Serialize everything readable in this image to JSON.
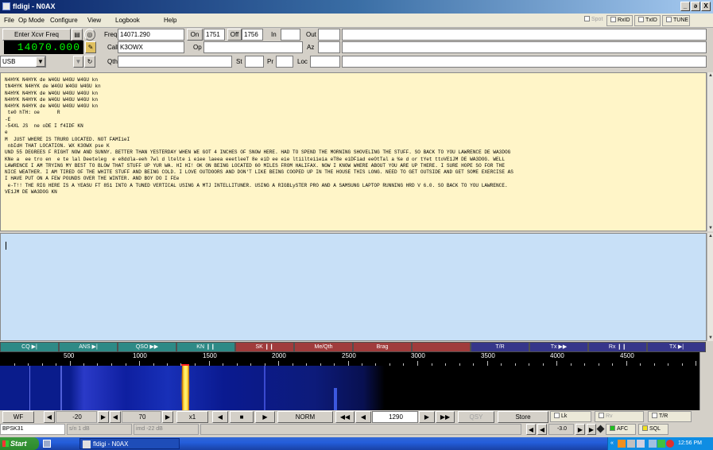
{
  "window": {
    "title": "fldigi - N0AX",
    "controls": [
      "_",
      "ə",
      "X"
    ]
  },
  "menubar": {
    "items": [
      "File",
      "Op Mode",
      "Configure",
      "View",
      "Logbook",
      "Help"
    ],
    "right_buttons": {
      "spot": "Spot",
      "rxid": "RxID",
      "txid": "TxID",
      "tune": "TUNE"
    }
  },
  "fields": {
    "enter_xcvr_freq": "Enter Xcvr Freq",
    "freq_label": "Freq",
    "freq_value": "14071.290",
    "on_label": "On",
    "on_value": "1751",
    "off_label": "Off",
    "off_value": "1756",
    "in_label": "In",
    "in_value": "",
    "out_label": "Out",
    "out_value": "",
    "call_label": "Call",
    "call_value": "K3OWX",
    "op_label": "Op",
    "op_value": "",
    "az_label": "Az",
    "az_value": "",
    "qth_label": "Qth",
    "qth_value": "",
    "st_label": "St",
    "st_value": "",
    "pr_label": "Pr",
    "pr_value": "",
    "loc_label": "Loc",
    "loc_value": "",
    "mode_select": "USB"
  },
  "frequency_display": "14070.000",
  "rx_text": [
    "N4HYK N4HYK de W4GU W4GU W4GU kn",
    "tN4HYK N4HYK de W4GU W4GU W4GU kn",
    "N4HYK N4HYK de W4GU W4GU W4GU kn",
    "N4HYK N4HYK de W4GU W4GU W4GU kn",
    "N4HYK N4HYK de W4GU W4GU W4GU kn",
    " te0 hTH: oe      R",
    "-E",
    "-54XL JS  ne oDE I f4IDF KN",
    "e",
    "M  JUST WHERE IS TRURO LOCATED. NOT FAMIieI",
    " nbIdH THAT LOCATION. WX K3OWX pse K",
    "UND 55 DEGREES F RIGHT NOW AND SUNNY. BETTER THAN YESTERDAY WHEN WE GOT 4 INCHES OF SNOW HERE. HAD TO SPEND THE MORNING SHOVELING THE STUFF. SO BACK TO YOU LAWRENCE DE WA3DOG",
    "KNe a  ee tro en  e te lal Deeteleg  e e8ddla-eeh 7wl d ltelte i eiee laeea eeetleeT 8e eiD ee eie ltiilteiieia eT8e eiDFiad eeOtTal a %e d or tYet ttoVE1JM DE WA3DOG. WELL",
    "LAWRENCE I AM TRYING MY BEST TO BLOW THAT STUFF UP YUR WA. HI HI! OK ON BEING LOCATED 60 MILES FROM HALIFAX. NOW I KNOW WHERE ABOUT YOU ARE UP THERE. I SURE HOPE SO FOR THE",
    "NICE WEATHER. I AM TIRED OF THE WHITE STUFF AND BEING COLD. I LOVE OUTDOORS AND DON'T LIKE BEING COOPED UP IN THE HOUSE THIS LONG. NEED TO GET OUTSIDE AND GET SOME EXERCISE AS",
    "I HAVE PUT ON A FEW POUNDS OVER THE WINTER. AND BOY DO I FEe",
    " e-T!! THE RIG HERE IS A YEASU FT 851 INTO A TUNED VERTICAL USING A MTJ INTELLITUNER. USING A RIGBLySTER PRO AND A SAMSUNG LAPTOP RUNNING HRD V 6.0. SO BACK TO YOU LAWRENCE.",
    "VE1JM DE WA3DOG KN"
  ],
  "tx_text": "",
  "macros": [
    {
      "label": "CQ ▶|",
      "color": "#2e8a86"
    },
    {
      "label": "ANS ▶|",
      "color": "#2e8a86"
    },
    {
      "label": "QSO ▶▶",
      "color": "#2e8a86"
    },
    {
      "label": "KN ❙❙",
      "color": "#2e8a86"
    },
    {
      "label": "SK ❙❙",
      "color": "#a03c3c"
    },
    {
      "label": "Me/Qth",
      "color": "#a03c3c"
    },
    {
      "label": "Brag",
      "color": "#a03c3c"
    },
    {
      "label": "",
      "color": "#a03c3c"
    },
    {
      "label": "T/R",
      "color": "#36368a"
    },
    {
      "label": "Tx ▶▶",
      "color": "#36368a"
    },
    {
      "label": "Rx ❙❙",
      "color": "#36368a"
    },
    {
      "label": "TX ▶|",
      "color": "#36368a"
    }
  ],
  "scale_ticks": [
    "500",
    "1000",
    "1500",
    "2000",
    "2500",
    "3000",
    "3500",
    "4000",
    "4500"
  ],
  "waterfall_bar": {
    "wf": "WF",
    "ref_level": "-20",
    "range": "70",
    "zoom": "x1",
    "norm": "NORM",
    "cursor_freq": "1290",
    "qsy": "QSY",
    "store": "Store",
    "lk": "Lk",
    "rv": "Rv",
    "tr": "T/R"
  },
  "status": {
    "mode": "BPSK31",
    "sn": "s/n  1 dB",
    "imd": "imd -22 dB",
    "squelch_level": "-3.0",
    "afc": "AFC",
    "sql": "SQL"
  },
  "taskbar": {
    "start": "Start",
    "app": "fldigi - N0AX",
    "clock": "12:56 PM"
  }
}
